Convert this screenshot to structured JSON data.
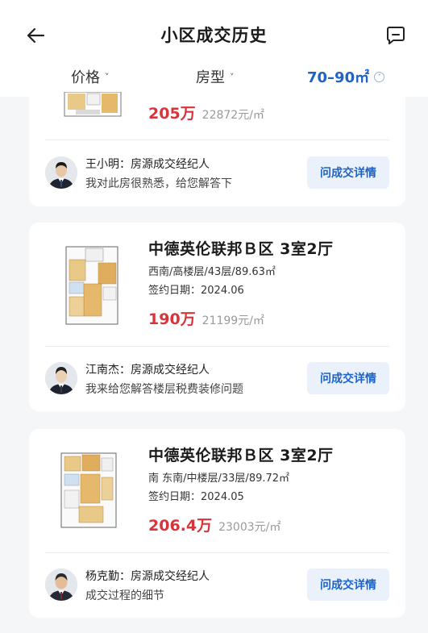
{
  "header": {
    "title": "小区成交历史",
    "back_icon": "arrow-left-icon",
    "message_icon": "chat-bubble-icon"
  },
  "filters": [
    {
      "label": "价格",
      "active": false
    },
    {
      "label": "房型",
      "active": false
    },
    {
      "label": "70–90㎡",
      "active": true
    }
  ],
  "accent_color": "#1f63c4",
  "price_color": "#d8343a",
  "listings": [
    {
      "title": "",
      "info": "",
      "date": "",
      "total_price": "205万",
      "unit_price": "22872元/㎡",
      "agent": {
        "name_line": "王小明：房源成交经纪人",
        "message": "我对此房很熟悉，给您解答下"
      },
      "button_label": "问成交详情"
    },
    {
      "title": "中德英伦联邦Ｂ区 3室2厅",
      "info": "西南/高楼层/43层/89.63㎡",
      "date": "签约日期：2024.06",
      "total_price": "190万",
      "unit_price": "21199元/㎡",
      "agent": {
        "name_line": "江南杰：房源成交经纪人",
        "message": "我来给您解答楼层税费装修问题"
      },
      "button_label": "问成交详情"
    },
    {
      "title": "中德英伦联邦Ｂ区 3室2厅",
      "info": "南 东南/中楼层/33层/89.72㎡",
      "date": "签约日期：2024.05",
      "total_price": "206.4万",
      "unit_price": "23003元/㎡",
      "agent": {
        "name_line": "杨克勤：房源成交经纪人",
        "message": "成交过程的细节"
      },
      "button_label": "问成交详情"
    }
  ]
}
